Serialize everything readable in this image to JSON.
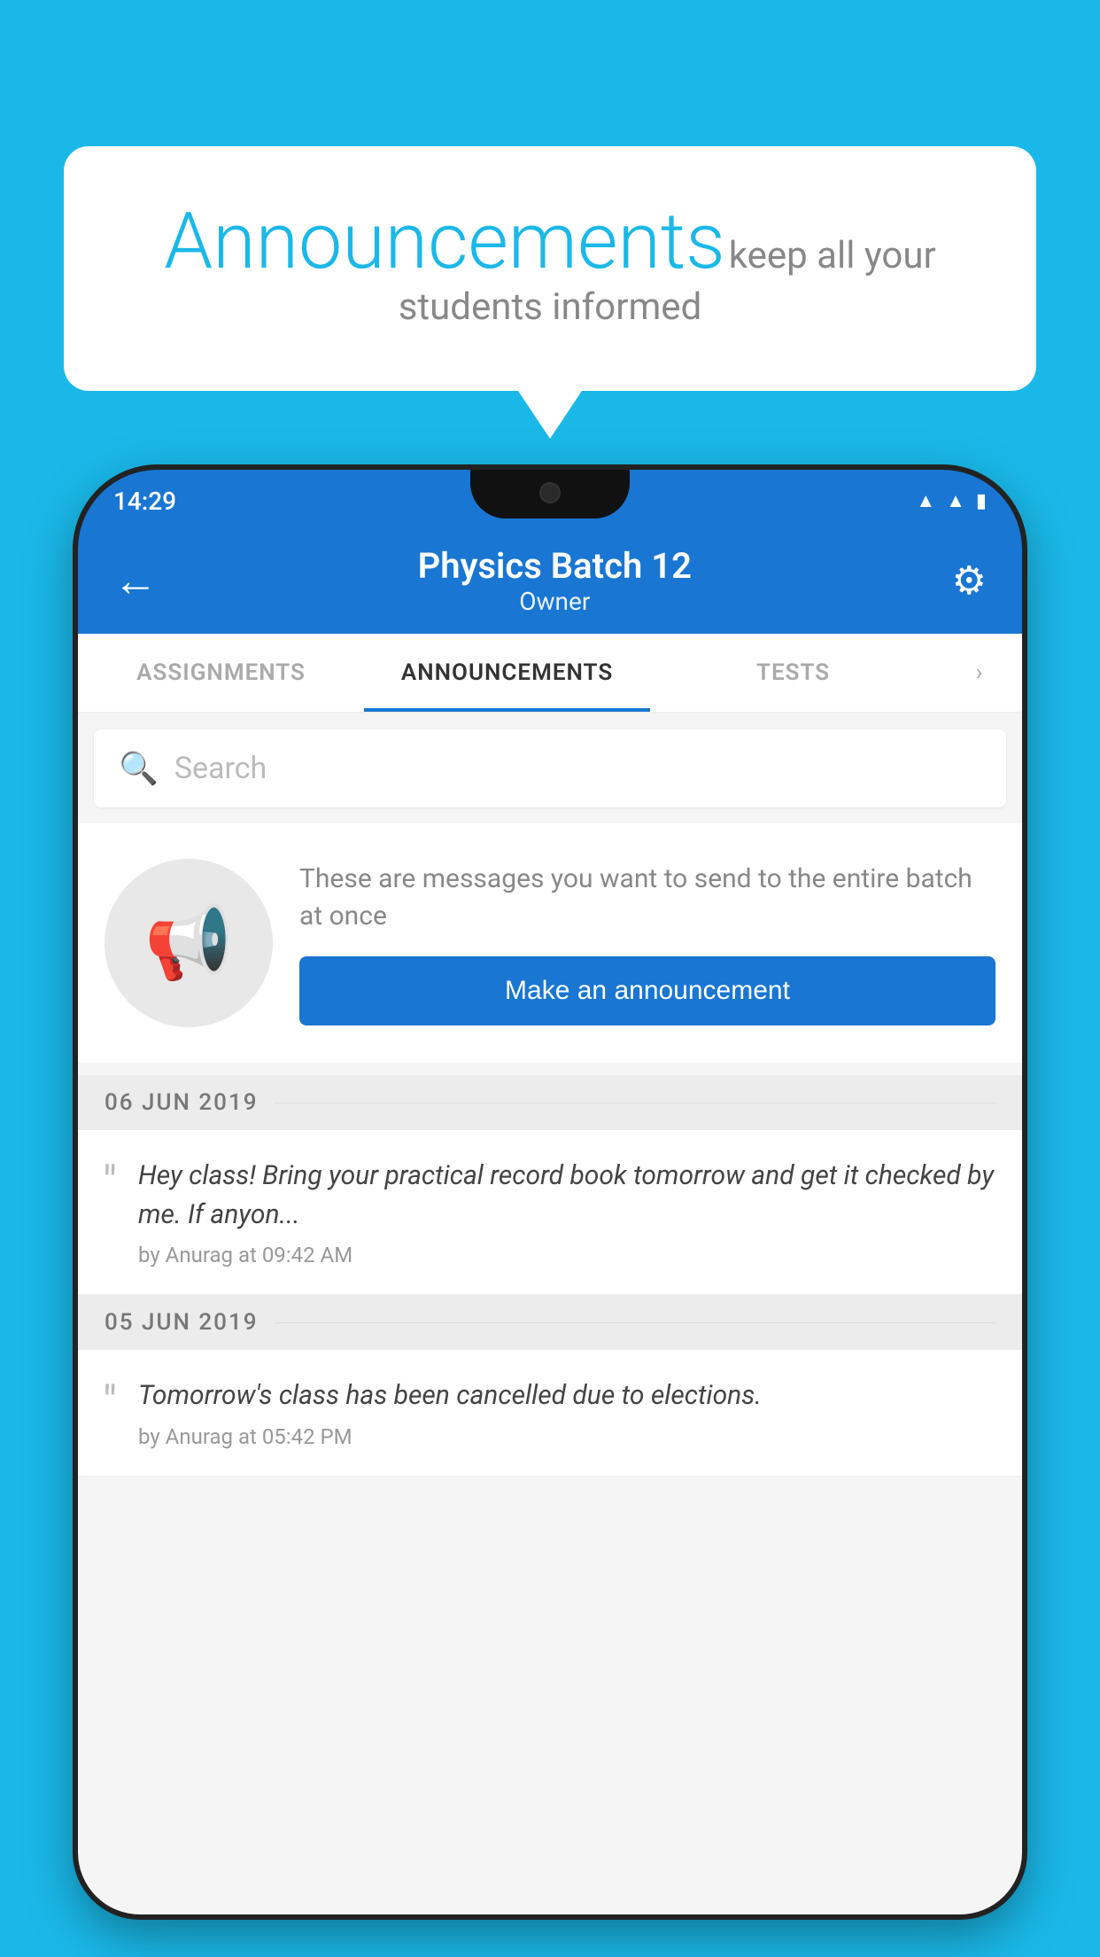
{
  "background": {
    "color": "#1ab8e8"
  },
  "speech_bubble": {
    "title": "Announcements",
    "subtitle": "keep all your students informed"
  },
  "phone": {
    "status_bar": {
      "time": "14:29",
      "icons": [
        "wifi",
        "signal",
        "battery"
      ]
    },
    "app_bar": {
      "title": "Physics Batch 12",
      "subtitle": "Owner",
      "back_label": "←",
      "settings_label": "⚙"
    },
    "tabs": [
      {
        "label": "ASSIGNMENTS",
        "active": false
      },
      {
        "label": "ANNOUNCEMENTS",
        "active": true
      },
      {
        "label": "TESTS",
        "active": false
      }
    ],
    "search": {
      "placeholder": "Search"
    },
    "promo": {
      "description": "These are messages you want to send to the entire batch at once",
      "button_label": "Make an announcement"
    },
    "announcements": [
      {
        "date": "06  JUN  2019",
        "text": "Hey class! Bring your practical record book tomorrow and get it checked by me. If anyon...",
        "meta": "by Anurag at 09:42 AM"
      },
      {
        "date": "05  JUN  2019",
        "text": "Tomorrow's class has been cancelled due to elections.",
        "meta": "by Anurag at 05:42 PM"
      }
    ]
  }
}
